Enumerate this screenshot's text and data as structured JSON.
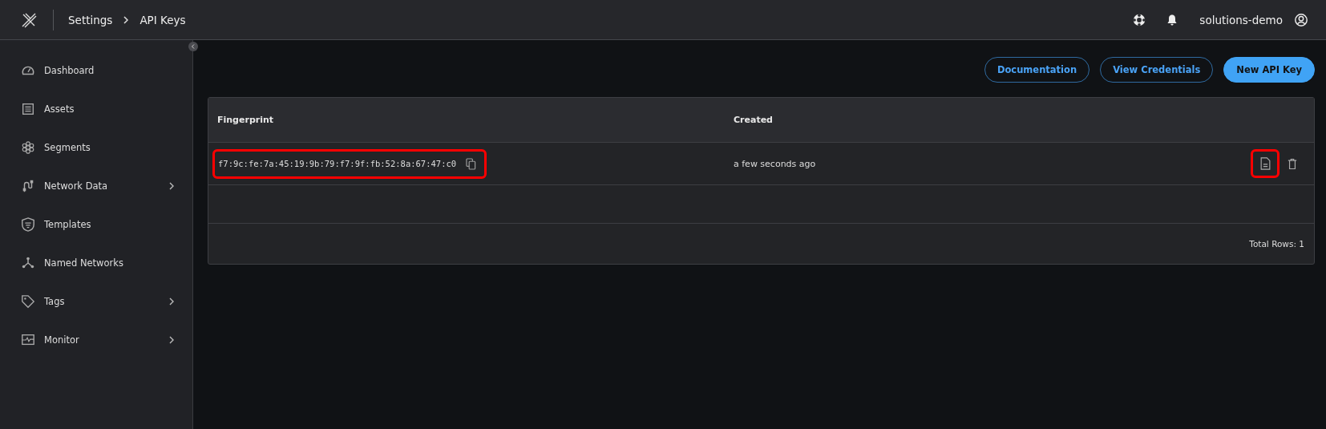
{
  "header": {
    "breadcrumb": [
      "Settings",
      "API Keys"
    ],
    "user": "solutions-demo"
  },
  "sidebar": {
    "items": [
      {
        "label": "Dashboard",
        "expandable": false
      },
      {
        "label": "Assets",
        "expandable": false
      },
      {
        "label": "Segments",
        "expandable": false
      },
      {
        "label": "Network Data",
        "expandable": true
      },
      {
        "label": "Templates",
        "expandable": false
      },
      {
        "label": "Named Networks",
        "expandable": false
      },
      {
        "label": "Tags",
        "expandable": true
      },
      {
        "label": "Monitor",
        "expandable": true
      }
    ]
  },
  "toolbar": {
    "buttons": [
      {
        "label": "Documentation",
        "kind": "outline"
      },
      {
        "label": "View Credentials",
        "kind": "outline"
      },
      {
        "label": "New API Key",
        "kind": "primary"
      }
    ]
  },
  "table": {
    "columns": [
      "Fingerprint",
      "Created"
    ],
    "rows": [
      {
        "fingerprint": "f7:9c:fe:7a:45:19:9b:79:f7:9f:fb:52:8a:67:47:c0",
        "created": "a few seconds ago",
        "fingerprint_highlighted": true,
        "details_highlighted": true
      }
    ],
    "footer": "Total Rows: 1"
  }
}
